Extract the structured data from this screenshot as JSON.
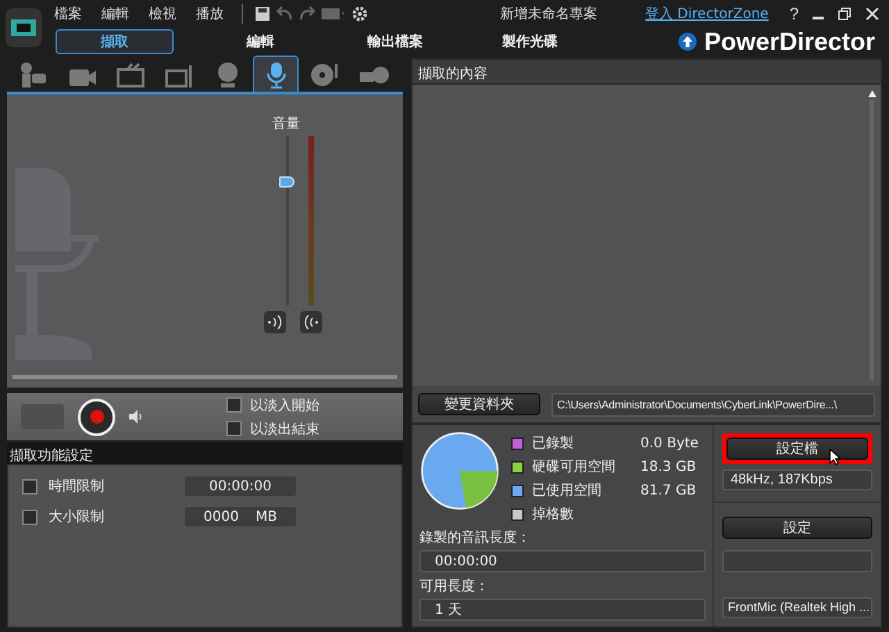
{
  "window": {
    "title": "新增未命名專案",
    "login_link": "登入 DirectorZone",
    "help": "?"
  },
  "menu": [
    "檔案",
    "編輯",
    "檢視",
    "播放"
  ],
  "modes": [
    {
      "label": "擷取",
      "selected": true
    },
    {
      "label": "編輯",
      "selected": false
    },
    {
      "label": "輸出檔案",
      "selected": false
    },
    {
      "label": "製作光碟",
      "selected": false
    }
  ],
  "brand": "PowerDirector",
  "devices": [
    {
      "kind": "camcorder",
      "selected": false
    },
    {
      "kind": "hdcam",
      "selected": false
    },
    {
      "kind": "tv",
      "selected": false
    },
    {
      "kind": "antenna",
      "selected": false
    },
    {
      "kind": "webcam",
      "selected": false
    },
    {
      "kind": "mic",
      "selected": true
    },
    {
      "kind": "disc",
      "selected": false
    },
    {
      "kind": "dvdcam",
      "selected": false
    }
  ],
  "volume": {
    "label": "音量",
    "level": 0.73
  },
  "fade_options": [
    {
      "label": "以淡入開始",
      "checked": false
    },
    {
      "label": "以淡出結束",
      "checked": false
    }
  ],
  "capture_settings": {
    "title": "擷取功能設定",
    "limits": [
      {
        "label": "時間限制",
        "checked": false,
        "value": "00:00:00"
      },
      {
        "label": "大小限制",
        "checked": false,
        "value": "0000",
        "unit": "MB"
      }
    ]
  },
  "captured_content": {
    "title": "擷取的內容"
  },
  "folder": {
    "button": "變更資料夾",
    "path": "C:\\Users\\Administrator\\Documents\\CyberLink\\PowerDire...\\"
  },
  "storage_legend": [
    {
      "label": "已錄製",
      "value": "0.0 Byte",
      "color": "#c060e0"
    },
    {
      "label": "硬碟可用空間",
      "value": "18.3 GB",
      "color": "#88d040"
    },
    {
      "label": "已使用空間",
      "value": "81.7 GB",
      "color": "#6aa8f0"
    },
    {
      "label": "掉格數",
      "color": "#c8c8c8"
    }
  ],
  "recorded_length": {
    "label": "錄製的音訊長度：",
    "value": "00:00:00"
  },
  "available_length": {
    "label": "可用長度：",
    "value": "1 天"
  },
  "profile": {
    "button": "設定檔",
    "highlighted": true,
    "value": "48kHz, 187Kbps"
  },
  "device_settings": {
    "button": "設定",
    "device": "FrontMic (Realtek High ..."
  }
}
